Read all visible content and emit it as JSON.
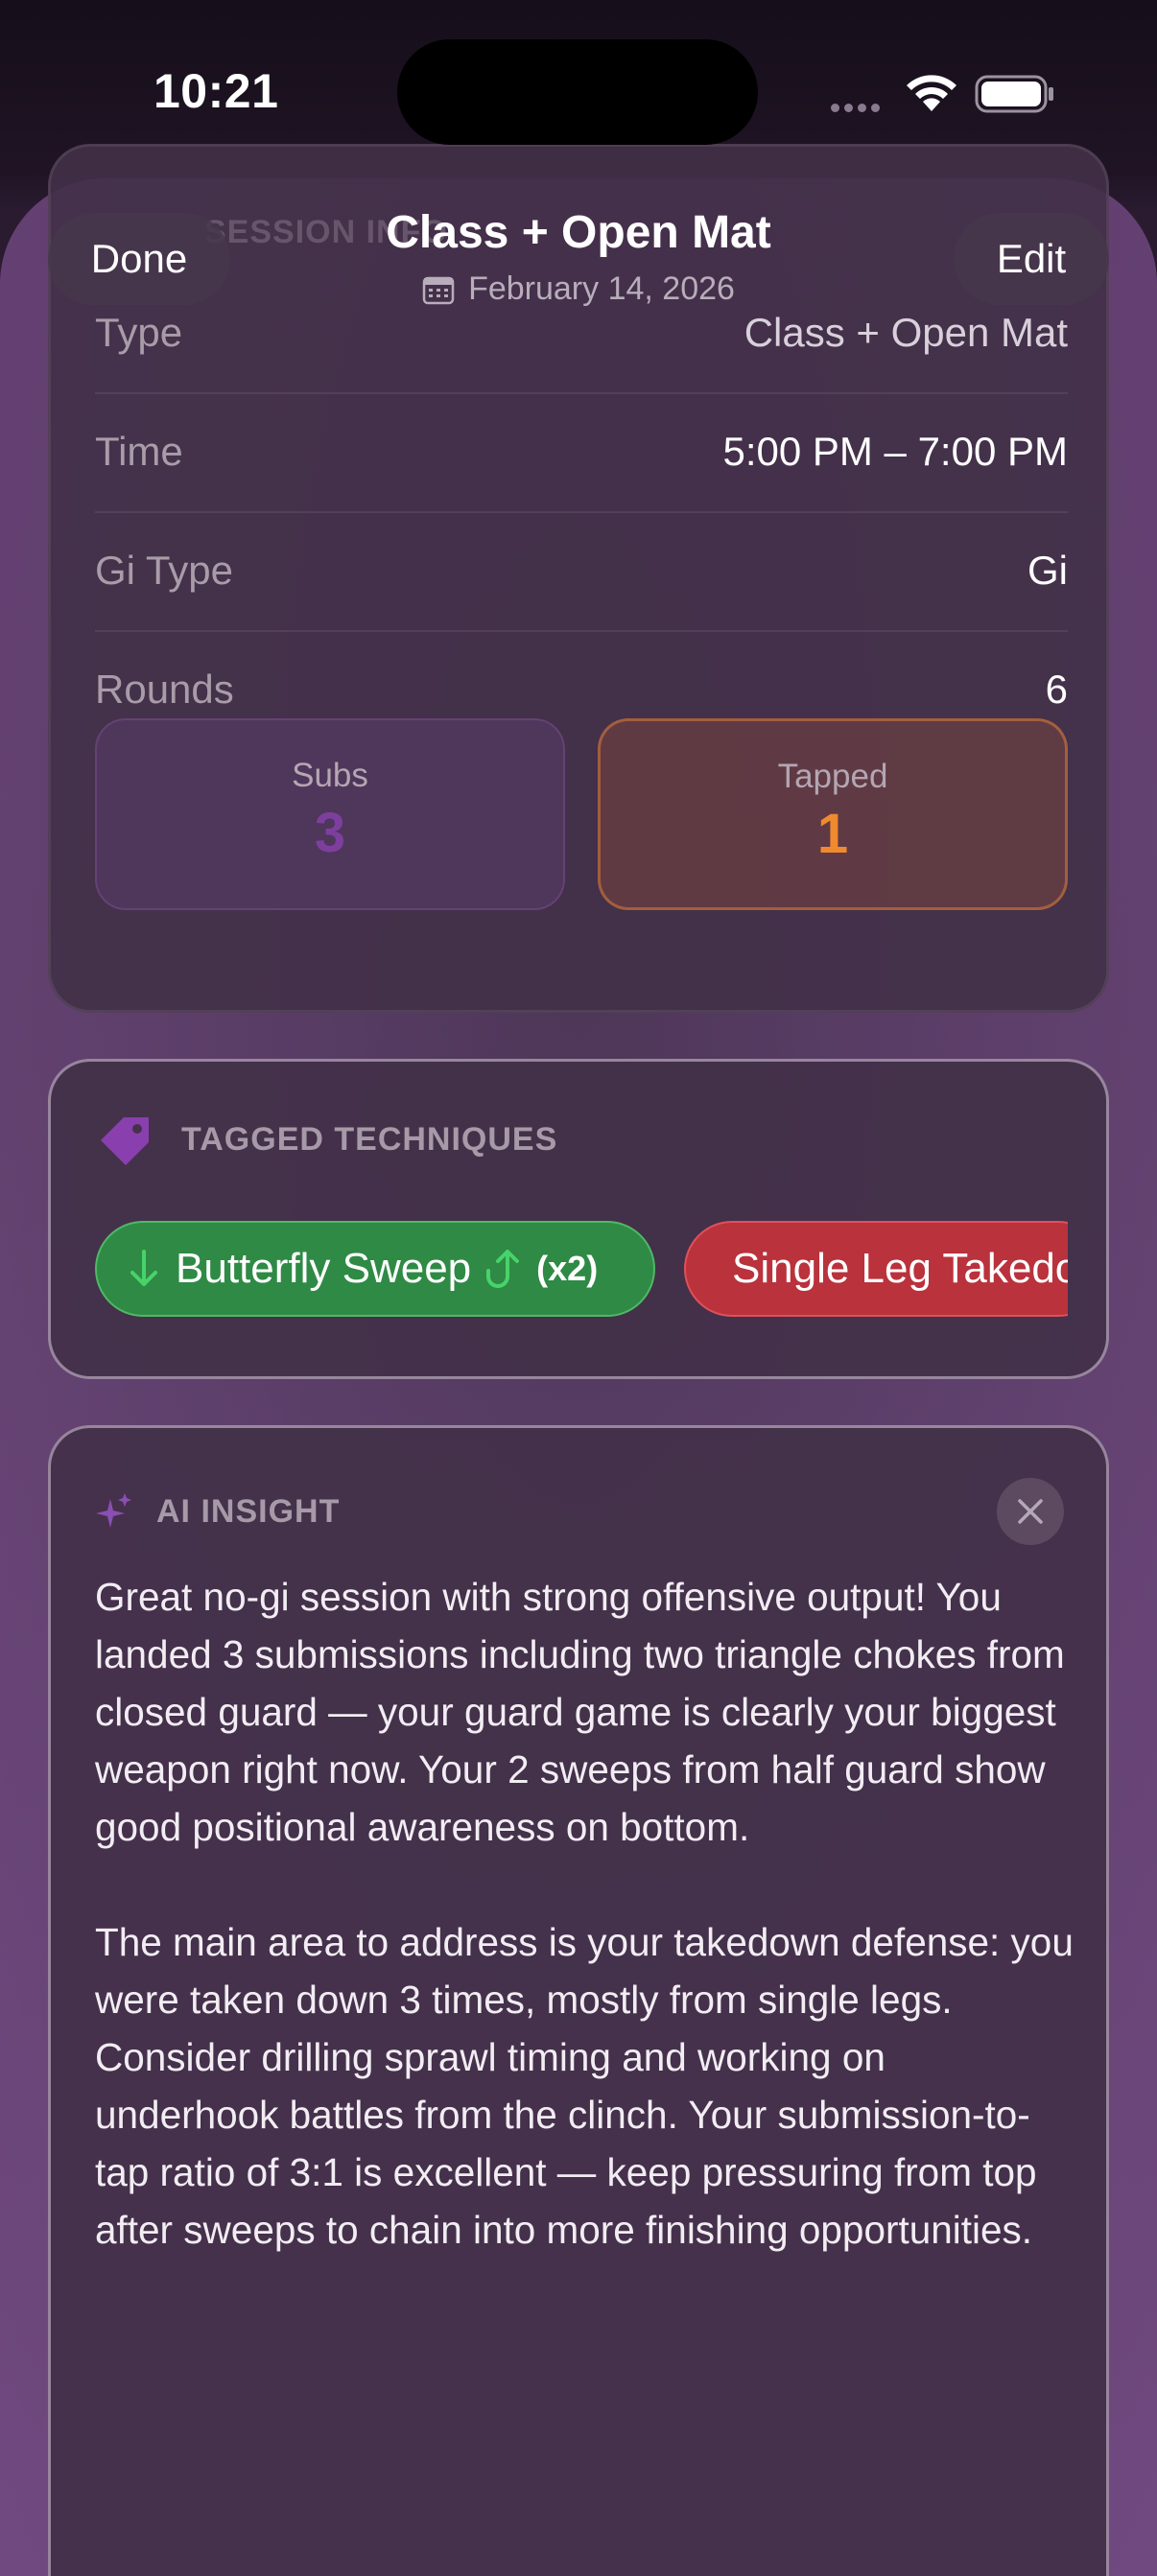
{
  "status_bar": {
    "time": "10:21"
  },
  "nav": {
    "done_label": "Done",
    "edit_label": "Edit",
    "title": "Class + Open Mat",
    "date": "February 14, 2026"
  },
  "session_info": {
    "header_faded": "SESSION INFO",
    "rows": [
      {
        "label": "Type",
        "value": "Class + Open Mat"
      },
      {
        "label": "Time",
        "value": "5:00 PM – 7:00 PM"
      },
      {
        "label": "Gi Type",
        "value": "Gi"
      },
      {
        "label": "Rounds",
        "value": "6"
      }
    ],
    "stats": [
      {
        "label": "Subs",
        "value": "3",
        "color": "#7d3f9e"
      },
      {
        "label": "Tapped",
        "value": "1",
        "color": "#f08a2e"
      }
    ]
  },
  "techniques": {
    "title": "TAGGED TECHNIQUES",
    "chips": [
      {
        "label": "Butterfly Sweep",
        "count": "(x2)",
        "color": "#2f8a45"
      },
      {
        "label": "Single Leg Takedown",
        "color": "#b9323c"
      }
    ]
  },
  "insight": {
    "title": "AI INSIGHT",
    "paragraphs": [
      "Great no-gi session with strong offensive output! You landed 3 submissions including two triangle chokes from closed guard — your guard game is clearly your biggest weapon right now. Your 2 sweeps from half guard show good positional awareness on bottom.",
      "The main area to address is your takedown defense: you were taken down 3 times, mostly from single legs. Consider drilling sprawl timing and working on underhook battles from the clinch. Your submission-to-tap ratio of 3:1 is excellent — keep pressuring from top after sweeps to chain into more finishing opportunities."
    ]
  }
}
